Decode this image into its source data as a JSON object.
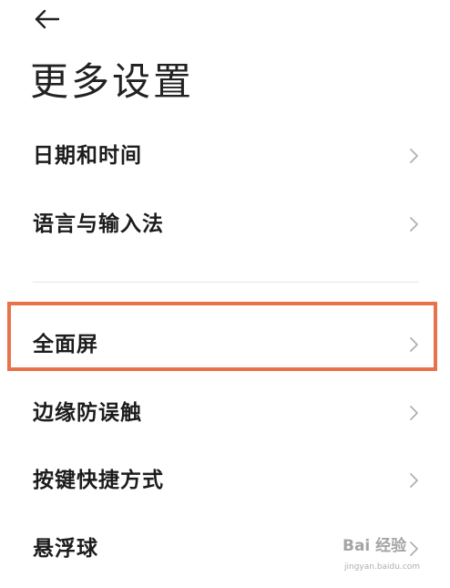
{
  "header": {
    "back_icon": "arrow-left-icon",
    "title": "更多设置"
  },
  "settings": {
    "items": [
      {
        "label": "日期和时间",
        "icon": "chevron-right-icon"
      },
      {
        "label": "语言与输入法",
        "icon": "chevron-right-icon"
      },
      {
        "label": "全面屏",
        "icon": "chevron-right-icon",
        "highlighted": true
      },
      {
        "label": "边缘防误触",
        "icon": "chevron-right-icon"
      },
      {
        "label": "按键快捷方式",
        "icon": "chevron-right-icon"
      },
      {
        "label": "悬浮球",
        "icon": "chevron-right-icon"
      }
    ]
  },
  "annotation": {
    "highlight_color": "#e8734a"
  },
  "watermark": {
    "logo": "Bai 经验",
    "url": "jingyan.baidu.com"
  },
  "colors": {
    "background": "#ffffff",
    "text": "#1c1c1c",
    "chevron": "#b0b0b0",
    "divider": "#e6e6e6"
  }
}
